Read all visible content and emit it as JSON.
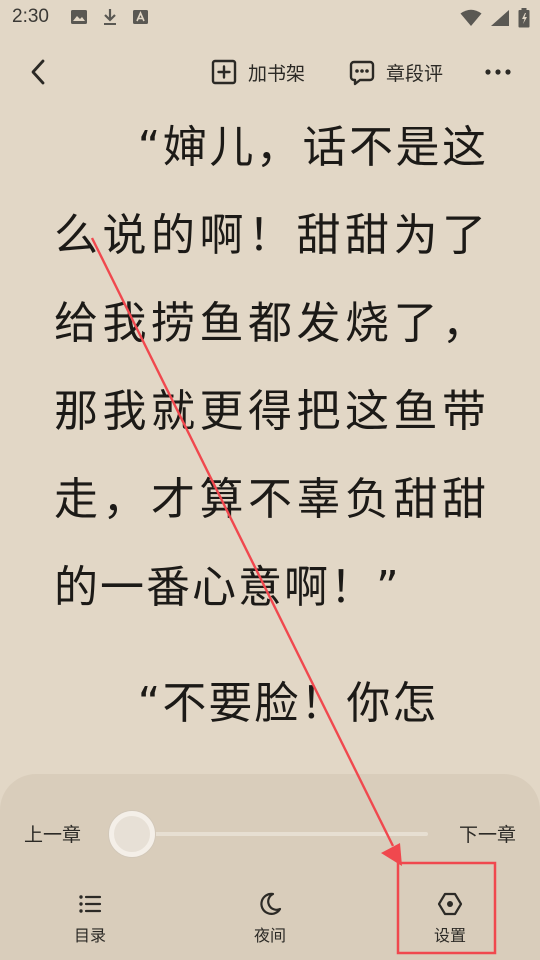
{
  "status_bar": {
    "time": "2:30",
    "left_icons": [
      "image-icon",
      "download-icon",
      "font-app-icon"
    ],
    "right_icons": [
      "wifi-icon",
      "signal-icon",
      "battery-icon"
    ]
  },
  "toolbar": {
    "back_icon": "chevron-left-icon",
    "add_bookshelf_label": "加书架",
    "add_bookshelf_icon": "add-box-icon",
    "paragraph_comment_label": "章段评",
    "paragraph_comment_icon": "comment-dots-icon",
    "more_icon": "more-horizontal-icon"
  },
  "content": {
    "paragraphs": [
      "“婶儿，话不是这么说的啊！甜甜为了给我捞鱼都发烧了，那我就更得把这鱼带走，才算不辜负甜甜的一番心意啊！”",
      "“不要脸！你怎"
    ]
  },
  "bottom_panel": {
    "prev_chapter_label": "上一章",
    "next_chapter_label": "下一章",
    "progress": 0.0,
    "tabs": [
      {
        "label": "目录",
        "icon": "list-icon"
      },
      {
        "label": "夜间",
        "icon": "moon-icon"
      },
      {
        "label": "设置",
        "icon": "settings-hexagon-icon"
      }
    ]
  },
  "colors": {
    "page_background": "#e2d7c6",
    "panel_background": "#d9cdbb",
    "text": "#1c1a17",
    "annotation": "#f0484e"
  }
}
